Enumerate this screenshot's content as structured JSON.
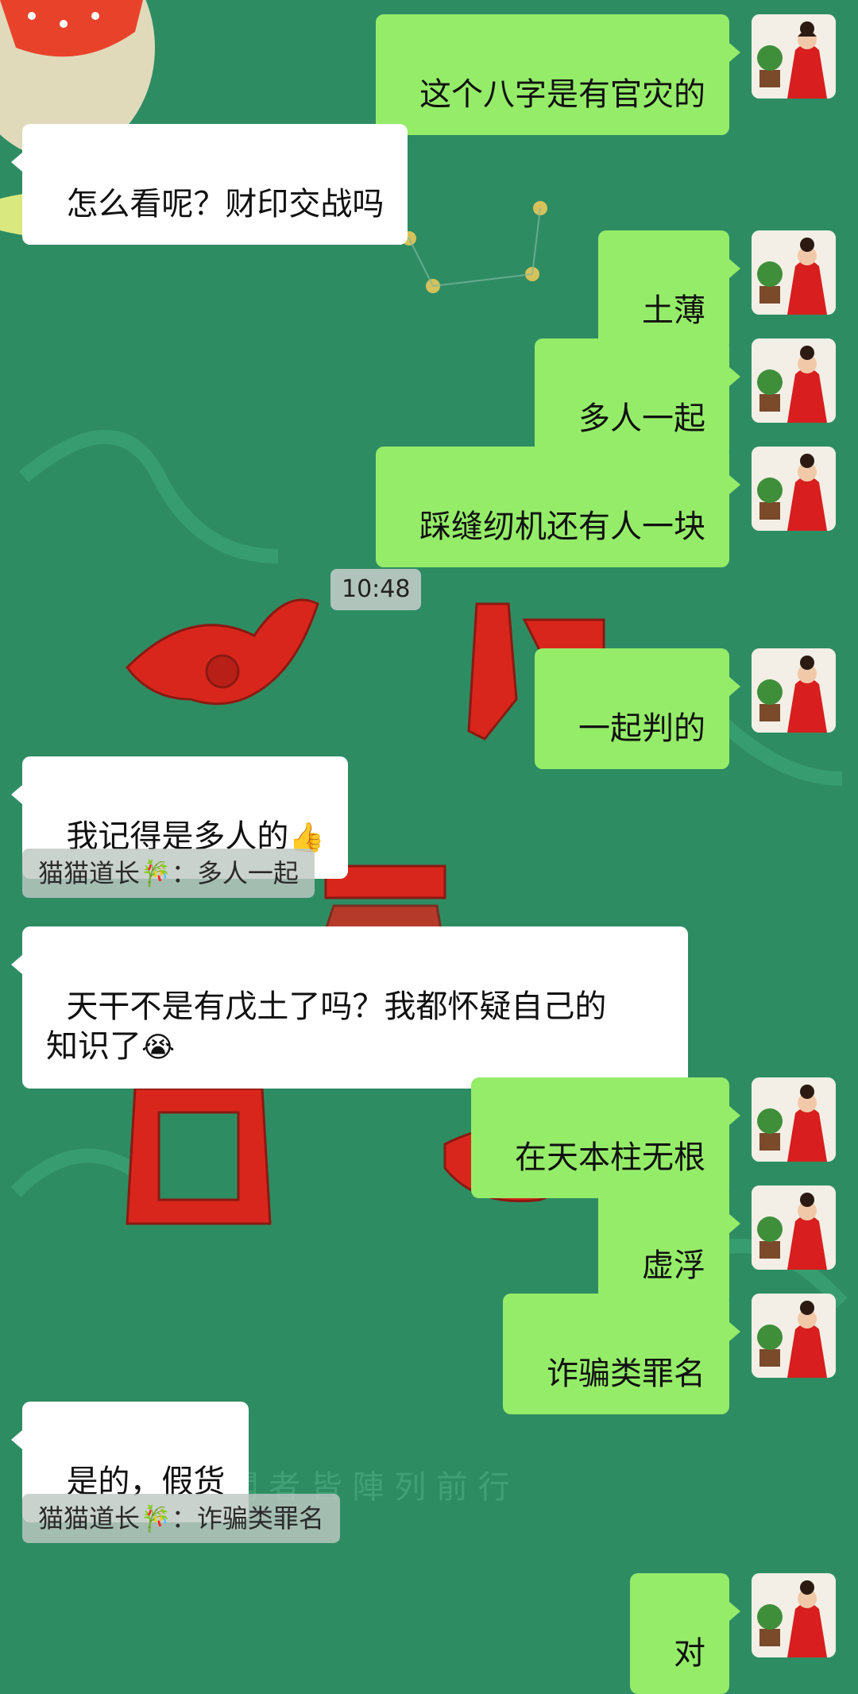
{
  "messages": [
    {
      "text": "这个八字是有官灾的"
    },
    {
      "text": "怎么看呢？财印交战吗"
    },
    {
      "text": "土薄"
    },
    {
      "text": "多人一起"
    },
    {
      "text": "踩缝纫机还有人一块"
    },
    {
      "text": "一起判的"
    },
    {
      "text": "我记得是多人的",
      "emoji": "👍"
    },
    {
      "text": "天干不是有戊土了吗？我都怀疑自己的\n知识了",
      "emoji": "😭"
    },
    {
      "text": "在天本柱无根"
    },
    {
      "text": "虚浮"
    },
    {
      "text": "诈骗类罪名"
    },
    {
      "text": "是的，假货"
    },
    {
      "text": "对"
    }
  ],
  "quotes": [
    {
      "text": "猫猫道长🎋：多人一起"
    },
    {
      "text": "猫猫道长🎋：诈骗类罪名"
    }
  ],
  "timestamp": "10:48",
  "colors": {
    "background": "#2e8c63",
    "my_bubble": "#95ec69",
    "other_bubble": "#ffffff",
    "decor_red": "#d9261c"
  },
  "icons": {
    "avatar": "avatar-woman-red-dress-icon"
  },
  "background_art": {
    "text": "匯 书 閣 者 皆 陣 列 前 行"
  }
}
